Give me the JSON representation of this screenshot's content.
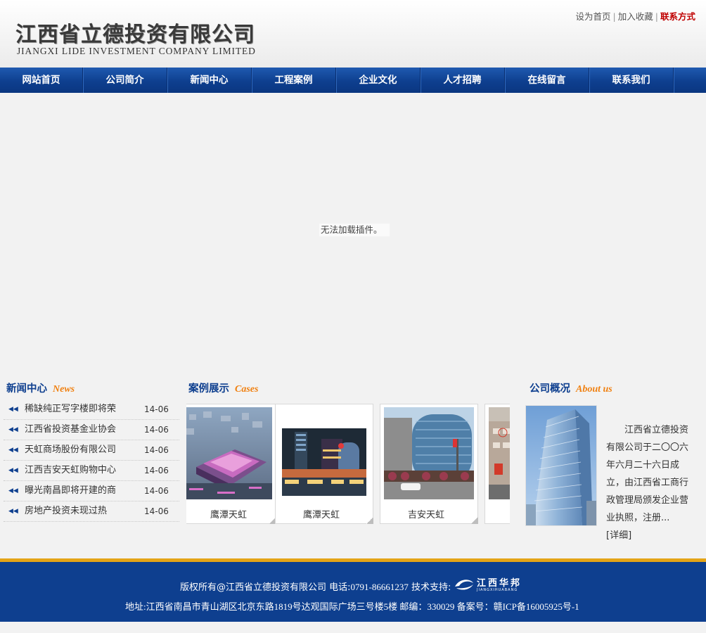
{
  "header": {
    "logo_cn": "江西省立德投资有限公司",
    "logo_en": "JIANGXI LIDE INVESTMENT COMPANY LIMITED",
    "toplinks": {
      "set_home": "设为首页",
      "sep": "|",
      "add_favorite": "加入收藏",
      "contact": "联系方式"
    }
  },
  "nav": {
    "items": [
      {
        "label": "网站首页"
      },
      {
        "label": "公司简介"
      },
      {
        "label": "新闻中心"
      },
      {
        "label": "工程案例"
      },
      {
        "label": "企业文化"
      },
      {
        "label": "人才招聘"
      },
      {
        "label": "在线留言"
      },
      {
        "label": "联系我们"
      }
    ]
  },
  "banner": {
    "plugin_message": "无法加载插件。"
  },
  "news": {
    "title_cn": "新闻中心",
    "title_en": "News",
    "items": [
      {
        "title": "稀缺纯正写字楼即将荣",
        "date": "14-06"
      },
      {
        "title": "江西省投资基金业协会",
        "date": "14-06"
      },
      {
        "title": "天虹商场股份有限公司",
        "date": "14-06"
      },
      {
        "title": "江西吉安天虹购物中心",
        "date": "14-06"
      },
      {
        "title": "曝光南昌即将开建的商",
        "date": "14-06"
      },
      {
        "title": "房地产投资未现过热",
        "date": "14-06"
      }
    ]
  },
  "cases": {
    "title_cn": "案例展示",
    "title_en": "Cases",
    "items": [
      {
        "caption": "鹰潭天虹"
      },
      {
        "caption": "鹰潭天虹"
      },
      {
        "caption": "吉安天虹"
      },
      {
        "caption": ""
      }
    ]
  },
  "about": {
    "title_cn": "公司概况",
    "title_en": "About us",
    "text": "江西省立德投资有限公司于二〇〇六年六月二十六日成立，由江西省工商行政管理局颁发企业营业执照，注册...",
    "more": "[详细]"
  },
  "footer": {
    "line1_prefix": "版权所有@江西省立德投资有限公司  电话:",
    "phone": "0791-86661237",
    "support_label": "  技术支持:",
    "support_logo_cn": "江西华邦",
    "support_logo_pinyin": "JIANGXIHUABANG",
    "line2": "地址:江西省南昌市青山湖区北京东路1819号达观国际广场三号楼5楼  邮编：330029 备案号：赣ICP备16005925号-1"
  },
  "colors": {
    "nav_blue": "#0e3f8f",
    "accent_orange": "#f08010",
    "contact_red": "#c00000",
    "footer_stripe": "#e4a417"
  }
}
